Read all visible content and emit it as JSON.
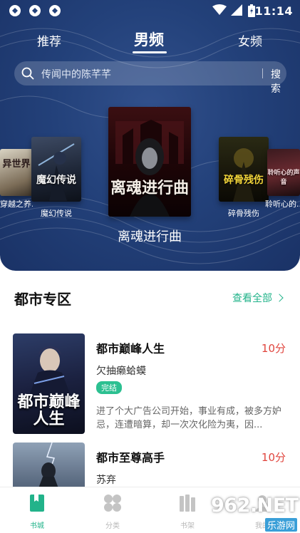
{
  "status_bar": {
    "time": "11:14"
  },
  "top_tabs": [
    {
      "label": "推荐",
      "active": false
    },
    {
      "label": "男频",
      "active": true
    },
    {
      "label": "女频",
      "active": false
    }
  ],
  "search": {
    "placeholder": "传闻中的陈芊芊",
    "button_label": "搜索"
  },
  "carousel": [
    {
      "caption": "穿越之养...",
      "cover_text": "异世界"
    },
    {
      "caption": "魔幻传说",
      "cover_text": "魔幻传说"
    },
    {
      "caption": "离魂进行曲",
      "cover_text": "离魂进行曲",
      "featured": true
    },
    {
      "caption": "碎骨残伤",
      "cover_text": "碎骨残伤"
    },
    {
      "caption": "聆听心的...",
      "cover_text": "聆听心的声音"
    }
  ],
  "section": {
    "title": "都市专区",
    "view_all_label": "查看全部"
  },
  "books": [
    {
      "title": "都市巅峰人生",
      "score": "10分",
      "author": "欠抽癞蛤蟆",
      "badge": "完结",
      "description": "进了个大广告公司开始，事业有成，被多方妒忌，连遭暗算，却一次次化险为夷，因...",
      "cover_text": "都市巅峰人生"
    },
    {
      "title": "都市至尊高手",
      "score": "10分",
      "author": "苏弃",
      "cover_text": ""
    }
  ],
  "bottom_nav": [
    {
      "label": "书城",
      "icon": "book-icon",
      "active": true
    },
    {
      "label": "分类",
      "icon": "grid-icon",
      "active": false
    },
    {
      "label": "书架",
      "icon": "bookshelf-icon",
      "active": false
    },
    {
      "label": "我的",
      "icon": "user-icon",
      "active": false
    }
  ],
  "watermark": {
    "logo_text": "962.NET",
    "sub_text": "乐游网"
  },
  "colors": {
    "hero": "#23417a",
    "accent": "#22b38a",
    "score": "#e0453e",
    "badge": "#2cc091"
  }
}
